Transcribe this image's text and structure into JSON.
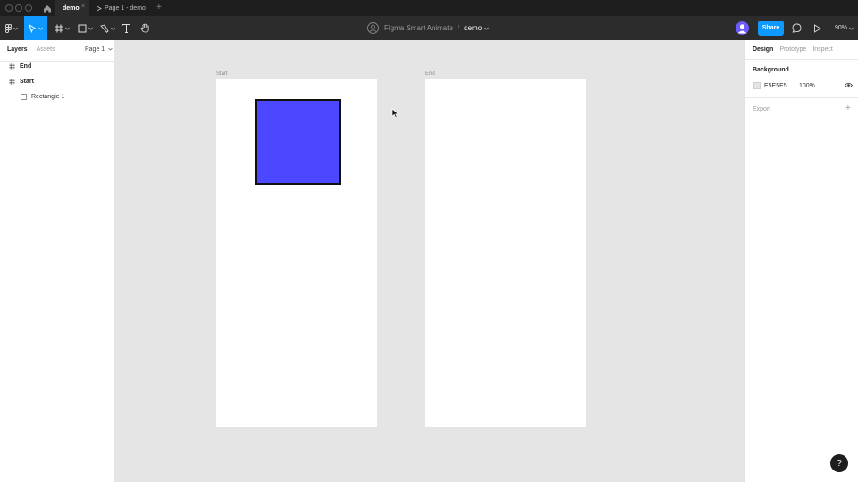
{
  "tabs": {
    "active_label": "demo",
    "close_symbol": "×",
    "second_label": "Page 1 - demo",
    "new_tab_symbol": "+"
  },
  "toolbar": {
    "breadcrumb_team": "Figma Smart Animate",
    "breadcrumb_separator": "/",
    "breadcrumb_file": "demo",
    "share_label": "Share",
    "zoom_level": "90%"
  },
  "left_panel": {
    "tab_layers": "Layers",
    "tab_assets": "Assets",
    "page_selector": "Page 1",
    "layers": [
      {
        "label": "End",
        "kind": "frame"
      },
      {
        "label": "Start",
        "kind": "frame"
      },
      {
        "label": "Rectangle 1",
        "kind": "rectangle"
      }
    ]
  },
  "canvas": {
    "frames": [
      {
        "label": "Start"
      },
      {
        "label": "End"
      }
    ],
    "rectangle_color": "#4b48ff",
    "background_color": "#e5e5e5"
  },
  "right_panel": {
    "tab_design": "Design",
    "tab_prototype": "Prototype",
    "tab_inspect": "Inspect",
    "background_title": "Background",
    "background_hex": "E5E5E5",
    "background_opacity": "100%",
    "export_label": "Export",
    "export_plus": "+"
  },
  "help": {
    "label": "?"
  },
  "colors": {
    "accent": "#0d99ff",
    "toolbar_bg": "#2c2c2c",
    "titlebar_bg": "#1e1e1e"
  }
}
